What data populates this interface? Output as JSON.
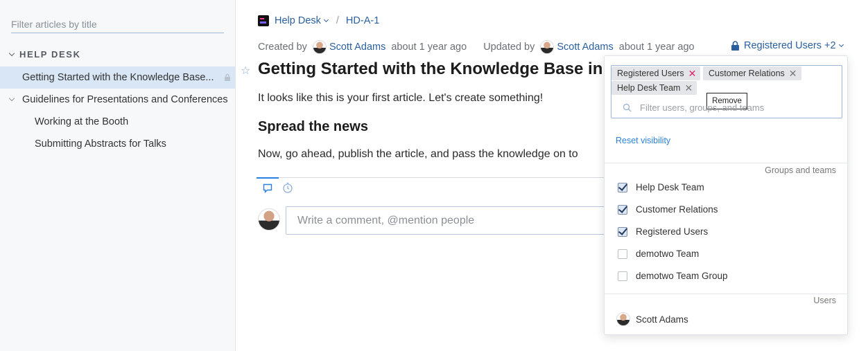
{
  "sidebar": {
    "filter_placeholder": "Filter articles by title",
    "section_title": "HELP DESK",
    "articles": [
      {
        "label": "Getting Started with the Knowledge Base..."
      },
      {
        "label": "Guidelines for Presentations and Conferences"
      },
      {
        "label": "Working at the Booth"
      },
      {
        "label": "Submitting Abstracts for Talks"
      }
    ]
  },
  "breadcrumb": {
    "project": "Help Desk",
    "separator": "/",
    "article_id": "HD-A-1"
  },
  "meta": {
    "created_by_label": "Created by",
    "created_by_user": "Scott Adams",
    "created_time": "about 1 year ago",
    "updated_by_label": "Updated by",
    "updated_by_user": "Scott Adams",
    "updated_time": "about 1 year ago",
    "visibility_label": "Registered Users +2"
  },
  "article": {
    "title": "Getting Started with the Knowledge Base in",
    "intro": "It looks like this is your first article. Let's create something!",
    "heading": "Spread the news",
    "body": "Now, go ahead, publish the article, and pass the knowledge on to"
  },
  "comment": {
    "placeholder": "Write a comment, @mention people"
  },
  "visibility_dropdown": {
    "tags": [
      "Registered Users",
      "Customer Relations",
      "Help Desk Team"
    ],
    "tooltip": "Remove",
    "search_placeholder": "Filter users, groups, and teams",
    "reset_label": "Reset visibility",
    "groups_label": "Groups and teams",
    "groups": [
      {
        "label": "Help Desk Team",
        "checked": true
      },
      {
        "label": "Customer Relations",
        "checked": true
      },
      {
        "label": "Registered Users",
        "checked": true
      },
      {
        "label": "demotwo Team",
        "checked": false
      },
      {
        "label": "demotwo Team Group",
        "checked": false
      }
    ],
    "users_label": "Users",
    "users": [
      {
        "label": "Scott Adams"
      }
    ]
  },
  "colors": {
    "accent": "#2a5f9e",
    "link": "#2b82d9",
    "remove_highlight": "#e0226e",
    "active_row": "#d8e6f5"
  }
}
